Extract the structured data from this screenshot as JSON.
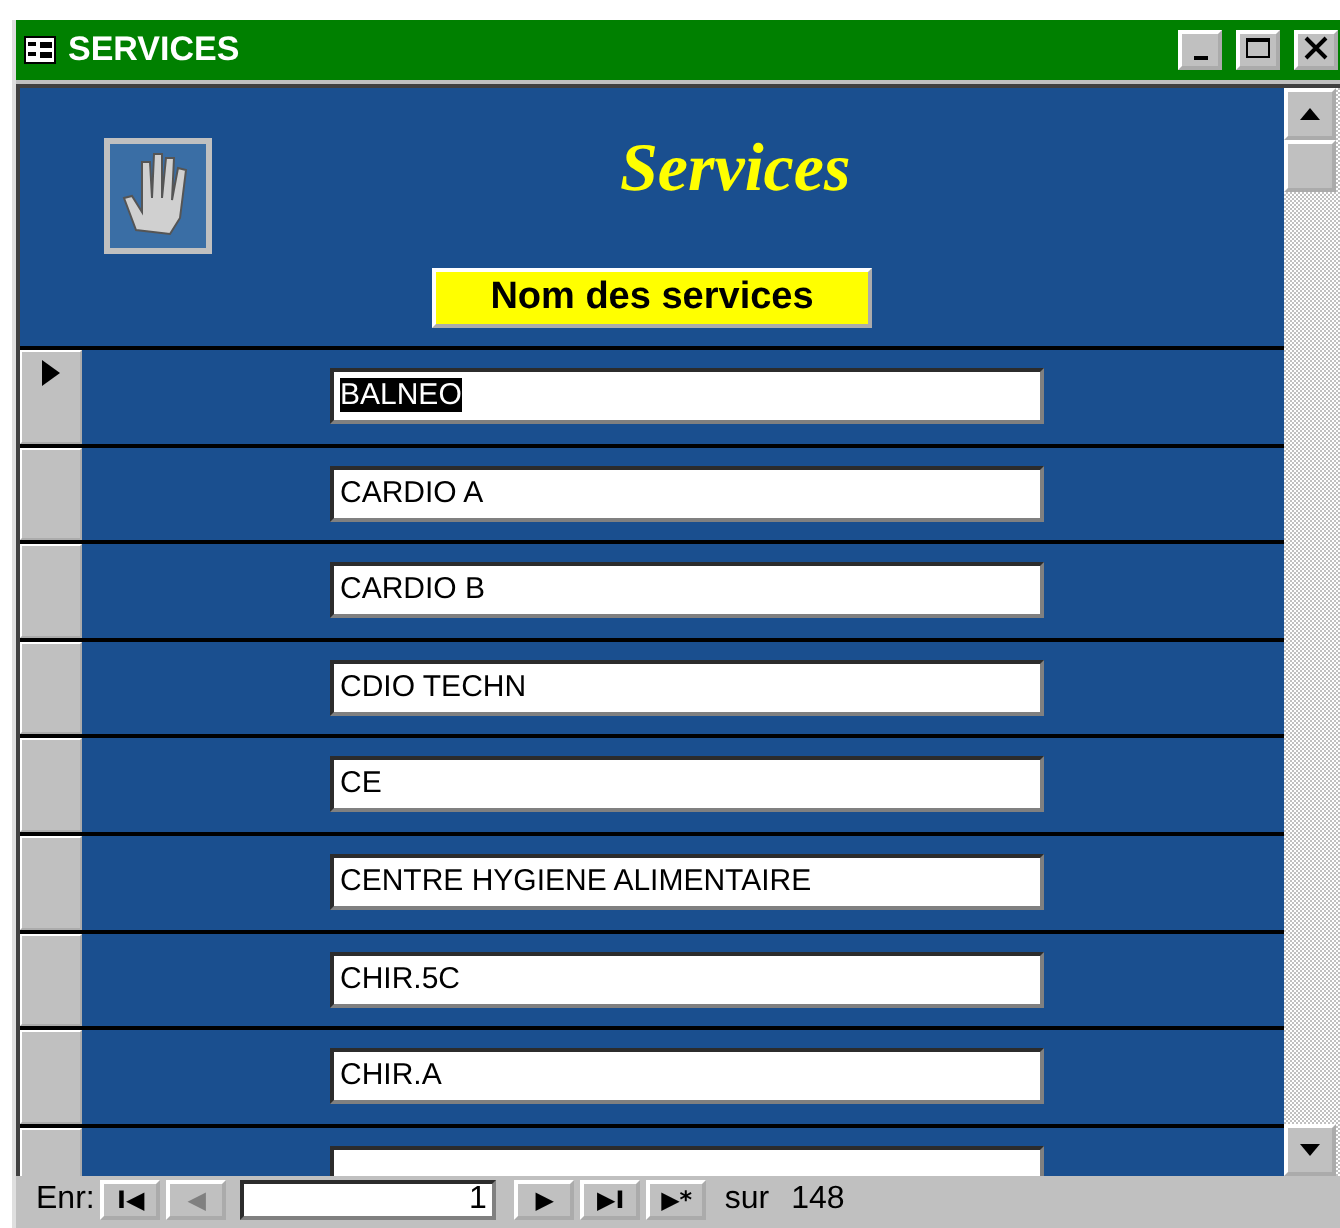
{
  "window": {
    "title": "SERVICES"
  },
  "header": {
    "title": "Services",
    "column_button": "Nom des services"
  },
  "rows": [
    {
      "value": "BALNEO",
      "current": true
    },
    {
      "value": "CARDIO A",
      "current": false
    },
    {
      "value": "CARDIO B",
      "current": false
    },
    {
      "value": "CDIO TECHN",
      "current": false
    },
    {
      "value": "CE",
      "current": false
    },
    {
      "value": "CENTRE HYGIENE ALIMENTAIRE",
      "current": false
    },
    {
      "value": "CHIR.5C",
      "current": false
    },
    {
      "value": "CHIR.A",
      "current": false
    },
    {
      "current": false
    }
  ],
  "navigation": {
    "label": "Enr:",
    "record": "1",
    "total_label": "sur",
    "total": "148",
    "first": "I◀",
    "previous": "◀",
    "next": "▶",
    "last": "▶I",
    "new": "▶*"
  }
}
